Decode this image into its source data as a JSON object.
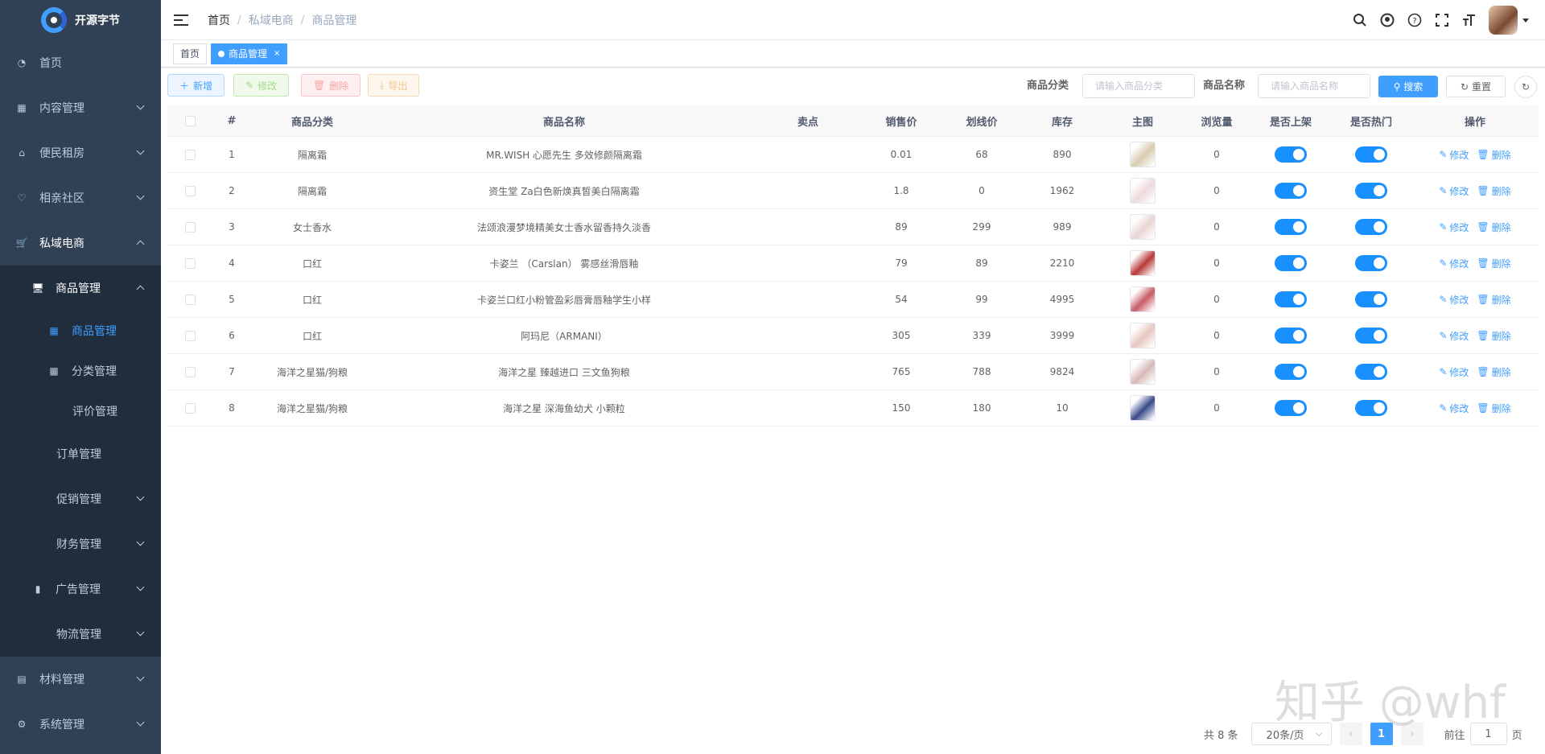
{
  "app": {
    "name": "开源字节"
  },
  "sidebar": {
    "items": [
      {
        "label": "首页",
        "icon": "dashboard-icon"
      },
      {
        "label": "内容管理",
        "icon": "table-icon"
      },
      {
        "label": "便民租房",
        "icon": "house-icon"
      },
      {
        "label": "相亲社区",
        "icon": "heart-icon"
      },
      {
        "label": "私域电商",
        "icon": "cart-icon"
      }
    ],
    "shop_sub": {
      "goods": {
        "label": "商品管理"
      },
      "goods_children": [
        {
          "label": "商品管理"
        },
        {
          "label": "分类管理"
        },
        {
          "label": "评价管理"
        }
      ],
      "order": "订单管理",
      "promo": "促销管理",
      "finance": "财务管理",
      "ads": "广告管理",
      "logistics": "物流管理"
    },
    "bottom": [
      {
        "label": "材料管理"
      },
      {
        "label": "系统管理"
      }
    ]
  },
  "breadcrumb": [
    "首页",
    "私域电商",
    "商品管理"
  ],
  "tags": {
    "home": "首页",
    "current": "商品管理",
    "close": "×"
  },
  "toolbar": {
    "add": "新增",
    "edit": "修改",
    "del": "删除",
    "export": "导出"
  },
  "search": {
    "category_label": "商品分类",
    "category_placeholder": "请输入商品分类",
    "name_label": "商品名称",
    "name_placeholder": "请输入商品名称",
    "search_btn": "搜索",
    "reset_btn": "重置"
  },
  "table": {
    "headers": [
      "#",
      "商品分类",
      "商品名称",
      "卖点",
      "销售价",
      "划线价",
      "库存",
      "主图",
      "浏览量",
      "是否上架",
      "是否热门",
      "操作"
    ],
    "rows": [
      [
        "1",
        "隔离霜",
        "MR.WISH 心愿先生 多效修颜隔离霜",
        "",
        "0.01",
        "68",
        "890",
        "",
        "0"
      ],
      [
        "2",
        "隔离霜",
        "资生堂 Za白色新焕真皙美白隔离霜",
        "",
        "1.8",
        "0",
        "1962",
        "",
        "0"
      ],
      [
        "3",
        "女士香水",
        "法颂浪漫梦境精美女士香水留香持久淡香",
        "",
        "89",
        "299",
        "989",
        "",
        "0"
      ],
      [
        "4",
        "口红",
        "卡姿兰 （Carslan） 雾感丝滑唇釉",
        "",
        "79",
        "89",
        "2210",
        "",
        "0"
      ],
      [
        "5",
        "口红",
        "卡姿兰口红小粉管盈彩唇膏唇釉学生小样",
        "",
        "54",
        "99",
        "4995",
        "",
        "0"
      ],
      [
        "6",
        "口红",
        "阿玛尼（ARMANI）",
        "",
        "305",
        "339",
        "3999",
        "",
        "0"
      ],
      [
        "7",
        "海洋之星猫/狗粮",
        "海洋之星 臻越进口 三文鱼狗粮",
        "",
        "765",
        "788",
        "9824",
        "",
        "0"
      ],
      [
        "8",
        "海洋之星猫/狗粮",
        "海洋之星 深海鱼幼犬 小颗粒",
        "",
        "150",
        "180",
        "10",
        "",
        "0"
      ]
    ],
    "action_edit": "修改",
    "action_del": "删除",
    "thumb_colors": [
      "#d9cbb0",
      "#efd9dc",
      "#ead4d4",
      "#b83a3a",
      "#c85c66",
      "#e8c6c0",
      "#d8b8b8",
      "#3a4a8a"
    ]
  },
  "pagination": {
    "total": "共 8 条",
    "size": "20条/页",
    "page": "1",
    "goto": "前往",
    "goto_val": "1",
    "page_unit": "页"
  },
  "watermark": "知乎 @whf",
  "colors": {
    "primary": "#409eff",
    "sidebar_bg": "#304156",
    "submenu_bg": "#1f2d3d"
  }
}
